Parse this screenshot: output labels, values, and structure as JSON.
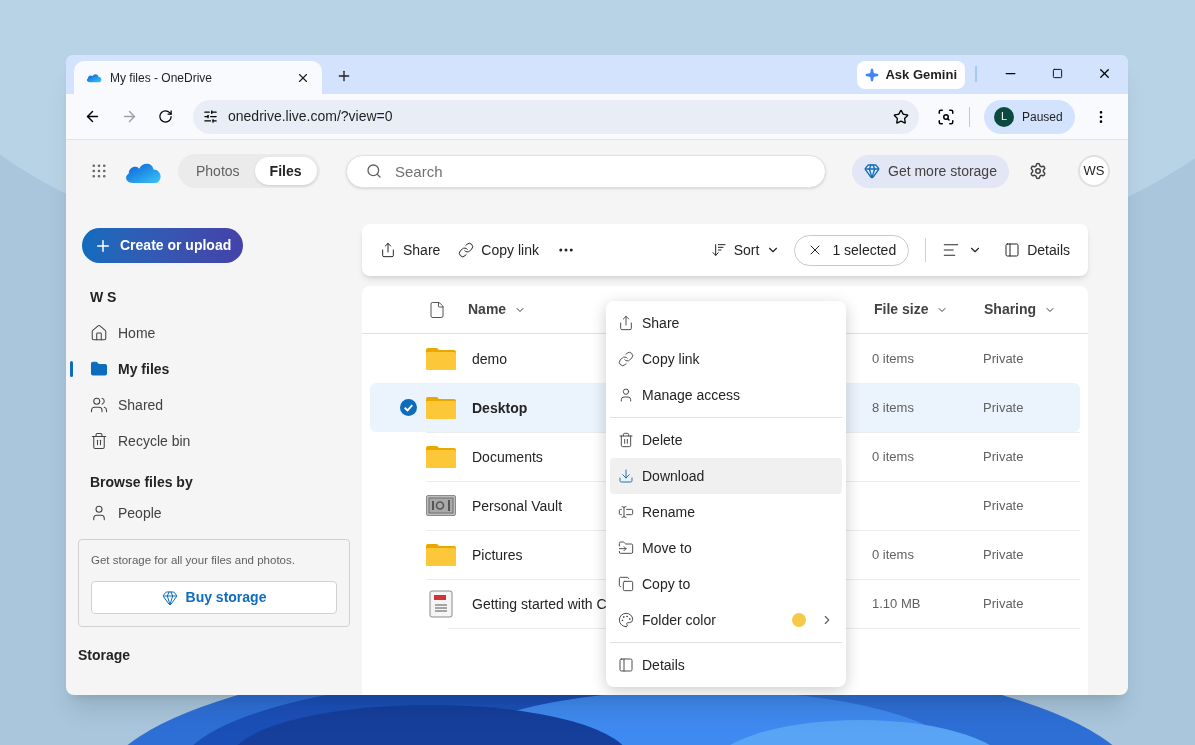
{
  "browser": {
    "tab_title": "My files - OneDrive",
    "ask_gemini": "Ask Gemini",
    "address": "onedrive.live.com/?view=0",
    "profile": {
      "initial": "L",
      "status": "Paused"
    }
  },
  "header": {
    "view_tabs": [
      {
        "label": "Photos",
        "selected": false
      },
      {
        "label": "Files",
        "selected": true
      }
    ],
    "search": {
      "placeholder": "Search"
    },
    "storage_button": "Get more storage",
    "avatar": "WS"
  },
  "sidebar": {
    "create_button": "Create or upload",
    "user": "W S",
    "items": [
      {
        "label": "Home",
        "selected": false
      },
      {
        "label": "My files",
        "selected": true
      },
      {
        "label": "Shared",
        "selected": false
      },
      {
        "label": "Recycle bin",
        "selected": false
      }
    ],
    "browse_heading": "Browse files by",
    "browse_items": [
      {
        "label": "People",
        "selected": false
      }
    ],
    "promo": {
      "text": "Get storage for all your files and photos.",
      "button": "Buy storage"
    },
    "storage_heading": "Storage"
  },
  "command_bar": {
    "actions": [
      "Share",
      "Copy link"
    ],
    "sort": "Sort",
    "selection": "1 selected",
    "details": "Details"
  },
  "table": {
    "columns": [
      "Name",
      "File size",
      "Sharing"
    ],
    "rows": [
      {
        "kind": "folder",
        "name": "demo",
        "size": "0 items",
        "sharing": "Private",
        "selected": false
      },
      {
        "kind": "folder",
        "name": "Desktop",
        "size": "8 items",
        "sharing": "Private",
        "selected": true
      },
      {
        "kind": "folder",
        "name": "Documents",
        "size": "0 items",
        "sharing": "Private",
        "selected": false
      },
      {
        "kind": "vault",
        "name": "Personal Vault",
        "sharing": "Private",
        "selected": false
      },
      {
        "kind": "folder",
        "name": "Pictures",
        "size": "0 items",
        "sharing": "Private",
        "selected": false
      },
      {
        "kind": "pdf",
        "name": "Getting started with C",
        "size": "1.10 MB",
        "sharing": "Private",
        "selected": false
      }
    ]
  },
  "context_menu": {
    "groups": [
      [
        {
          "label": "Share",
          "hovered": false
        },
        {
          "label": "Copy link",
          "hovered": false
        },
        {
          "label": "Manage access",
          "hovered": false
        }
      ],
      [
        {
          "label": "Delete",
          "hovered": false
        },
        {
          "label": "Download",
          "hovered": true
        },
        {
          "label": "Rename",
          "hovered": false
        },
        {
          "label": "Move to",
          "hovered": false
        },
        {
          "label": "Copy to",
          "hovered": false
        },
        {
          "label": "Folder color",
          "hovered": false,
          "color": "#f7c948"
        }
      ],
      [
        {
          "label": "Details",
          "hovered": false
        }
      ]
    ]
  }
}
